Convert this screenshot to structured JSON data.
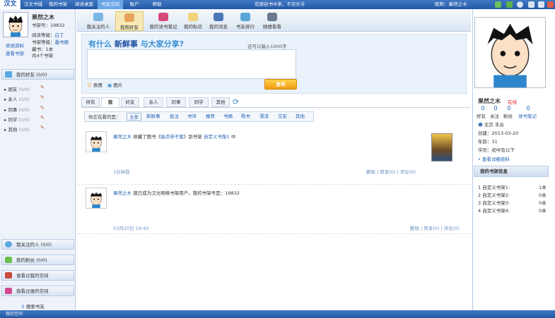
{
  "topbar": {
    "logo": "汉文",
    "nav": [
      "汉文书城",
      "我的书架",
      "阅读桌面",
      "书友空间",
      "账户",
      "帮助"
    ],
    "active_nav": "书友空间",
    "slogan": "有朋自书中来，不亦乐乎",
    "nickname": "昵称：果然之木"
  },
  "left": {
    "username": "果然之木",
    "shelf_no": "书架号：19832",
    "read_level_label": "阅读等级：",
    "read_level": "白丁",
    "shelf_level_label": "书架等级：",
    "shelf_level": "蠹书阁",
    "collect": "藏书：1本",
    "total": "共4个书架",
    "edit_profile": "修改资料",
    "view_shelf": "查看书架",
    "friends_header": "我的好友 (0/0)",
    "groups": [
      {
        "name": "朋友",
        "count": "(0/0)"
      },
      {
        "name": "亲人",
        "count": "(0/0)"
      },
      {
        "name": "同事",
        "count": "(0/0)"
      },
      {
        "name": "同学",
        "count": "(0/0)"
      },
      {
        "name": "其他",
        "count": "(0/0)"
      }
    ],
    "follow_header": "我关注的人 (0/0)",
    "fans_header": "我的粉丝 (0/0)",
    "visitors_header": "谁看过我的空间",
    "visited_header": "我看过谁的空间",
    "search_friend": "搜索书友"
  },
  "center": {
    "tabs": [
      "我关注的人",
      "我和好友",
      "我的读书笔记",
      "我的私信",
      "我的消息",
      "书友排行",
      "随便看看"
    ],
    "active_tab": "我和好友",
    "post_title_pre": "有什么",
    "post_title_bold": "新鲜事",
    "post_title_post": "与大家分享?",
    "word_limit": "还可以输入1000字",
    "emoji": "表情",
    "image": "图片",
    "publish": "发布",
    "feed_tabs": [
      "所有",
      "我",
      "好友",
      "亲人",
      "同事",
      "同学",
      "其他"
    ],
    "active_feed_tab": "我",
    "filter_label": "你正在看的是：",
    "filters": [
      "全部",
      "新鲜事",
      "批注",
      "书评",
      "推荐",
      "书摘",
      "购书",
      "漂流",
      "交友",
      "其他"
    ],
    "active_filter": "全部",
    "feeds": [
      {
        "name": "果然之木",
        "text1": "收藏了图书《",
        "book": "挺点带子案",
        "text2": "》到书架",
        "shelf": "自定义书架1",
        "text3": "中",
        "time": "1分钟前",
        "del": "删除",
        "forward": "转发(0)",
        "comment": "评论(0)"
      },
      {
        "name": "果然之木",
        "text": "我已成为汉文网络书架用户，我的书架号是：19832",
        "time": "03月20日  19:43",
        "del": "删除",
        "forward": "转发(0)",
        "comment": "评论(0)"
      }
    ]
  },
  "right": {
    "username": "果然之木",
    "status": "在线",
    "stats": [
      {
        "num": "0",
        "label": "好友"
      },
      {
        "num": "0",
        "label": "关注"
      },
      {
        "num": "0",
        "label": "粉丝"
      },
      {
        "num": "0",
        "label": "读书笔记"
      }
    ],
    "location": "北京  丰台",
    "created": "创建：2013-03-20",
    "age": "年龄：31",
    "edu": "学历：初中及以下",
    "more": "查看详细资料",
    "shelf_header": "我的书架信息",
    "shelves": [
      {
        "name": "1 自定义书架1:",
        "count": "1本"
      },
      {
        "name": "2 自定义书架2:",
        "count": "0本"
      },
      {
        "name": "3 自定义书架3:",
        "count": "0本"
      },
      {
        "name": "4 自定义书架4:",
        "count": "0本"
      }
    ]
  },
  "bottom": {
    "text": "我的空间"
  }
}
